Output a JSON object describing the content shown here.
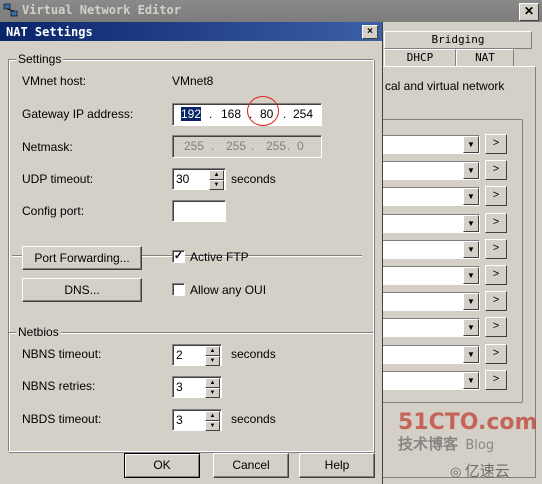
{
  "background_window": {
    "title": "Virtual Network Editor",
    "tabs_row1": [
      "Bridging"
    ],
    "tabs_row2": [
      "DHCP",
      "NAT"
    ],
    "description": "cal and virtual network",
    "combo_button_label": ">",
    "combo_count": 10
  },
  "dialog": {
    "title": "NAT Settings",
    "close_label": "×",
    "settings_legend": "Settings",
    "vmnet_host_label": "VMnet host:",
    "vmnet_host_value": "VMnet8",
    "gateway_label": "Gateway IP address:",
    "gateway_octets": [
      "192",
      "168",
      "80",
      "254"
    ],
    "netmask_label": "Netmask:",
    "netmask_octets": [
      "255",
      "255",
      "255",
      "0"
    ],
    "udp_timeout_label": "UDP timeout:",
    "udp_timeout_value": "30",
    "udp_timeout_unit": "seconds",
    "config_port_label": "Config port:",
    "config_port_value": "",
    "port_forwarding_button": "Port Forwarding...",
    "dns_button": "DNS...",
    "active_ftp_label": "Active FTP",
    "active_ftp_checked": true,
    "allow_any_oui_label": "Allow any OUI",
    "allow_any_oui_checked": false,
    "netbios_legend": "Netbios",
    "nbns_timeout_label": "NBNS timeout:",
    "nbns_timeout_value": "2",
    "nbns_timeout_unit": "seconds",
    "nbns_retries_label": "NBNS retries:",
    "nbns_retries_value": "3",
    "nbds_timeout_label": "NBDS timeout:",
    "nbds_timeout_value": "3",
    "nbds_timeout_unit": "seconds",
    "ok_button": "OK",
    "cancel_button": "Cancel",
    "help_button": "Help"
  },
  "watermark": {
    "line1": "51CTO.com",
    "line2": "技术博客",
    "line3": "Blog",
    "brand": "亿速云"
  },
  "colors": {
    "dialog_title_bar": "#0a246a",
    "inactive_title_bar": "#808080",
    "annotation_circle": "#e02020",
    "watermark_red": "#c0392b"
  }
}
